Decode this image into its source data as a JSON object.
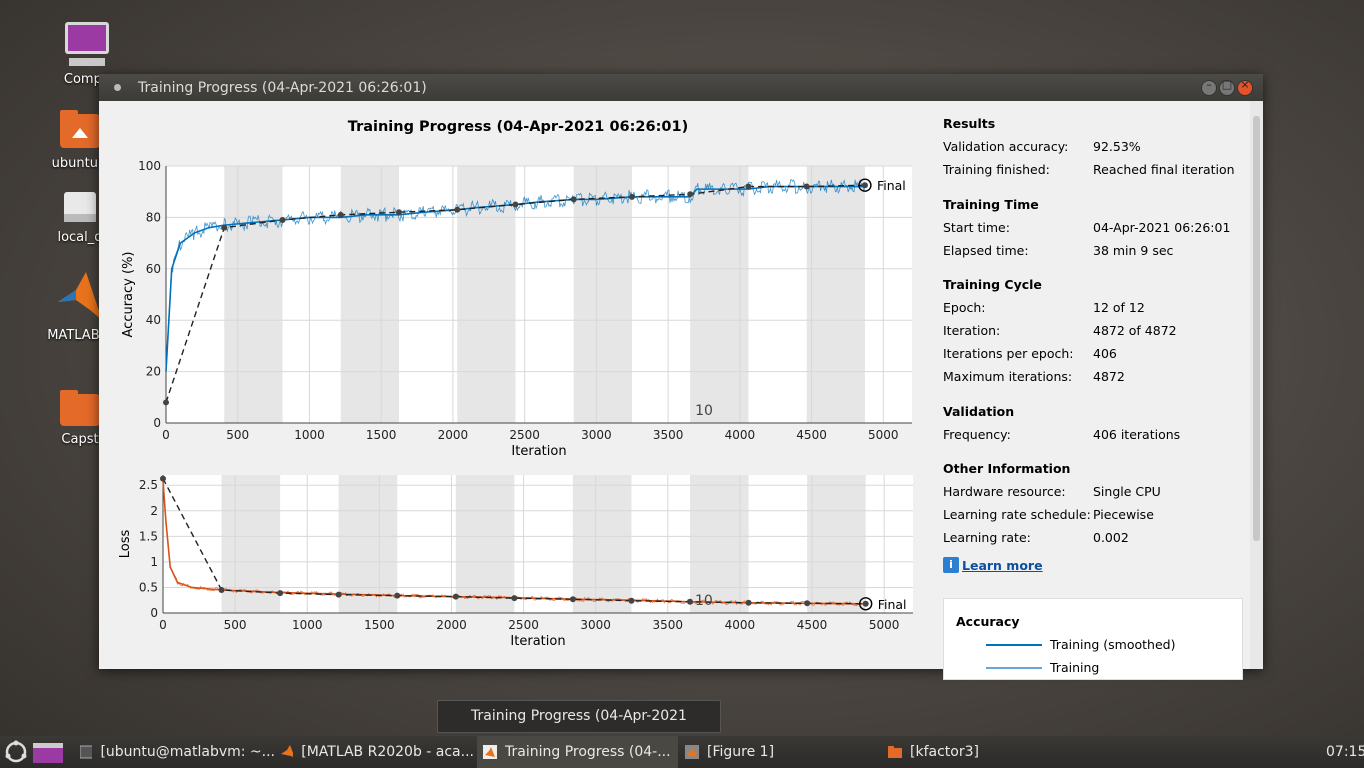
{
  "desktop": {
    "icons": [
      {
        "label": "Compu",
        "icon": "computer-icon"
      },
      {
        "label": "ubuntu's",
        "icon": "home-folder-icon"
      },
      {
        "label": "local_d",
        "icon": "drive-icon"
      },
      {
        "label": "MATLAB R",
        "icon": "matlab-icon"
      },
      {
        "label": "Capst",
        "icon": "folder-icon"
      }
    ]
  },
  "window": {
    "title": "Training Progress (04-Apr-2021 06:26:01)",
    "plot_title": "Training Progress (04-Apr-2021 06:26:01)"
  },
  "chart_data": [
    {
      "type": "line",
      "title": "Training Progress (04-Apr-2021 06:26:01)",
      "xlabel": "Iteration",
      "ylabel": "Accuracy (%)",
      "xlim": [
        0,
        5200
      ],
      "ylim": [
        0,
        100
      ],
      "xticks": [
        "0",
        "500",
        "1000",
        "1500",
        "2000",
        "2500",
        "3000",
        "3500",
        "4000",
        "4500",
        "5000"
      ],
      "yticks": [
        "0",
        "20",
        "40",
        "60",
        "80",
        "100"
      ],
      "epoch_label": "10",
      "final_label": "Final",
      "series": [
        {
          "color": "#0072bd",
          "x": [
            0,
            40,
            100,
            200,
            300,
            406,
            600,
            812,
            1000,
            1218,
            1400,
            1624,
            1800,
            2030,
            2200,
            2436,
            2600,
            2842,
            3000,
            3248,
            3400,
            3654,
            3700,
            3900,
            4060,
            4200,
            4466,
            4700,
            4872
          ],
          "y": [
            20,
            60,
            70,
            74,
            76,
            77,
            78,
            79,
            80,
            80,
            81,
            81,
            82,
            83,
            84,
            85,
            86,
            87,
            87,
            88,
            88,
            88,
            91,
            91,
            91,
            92,
            92,
            92,
            92
          ]
        },
        {
          "color": "#000000",
          "dashed": true,
          "x": [
            0,
            406,
            812,
            1218,
            1624,
            2030,
            2436,
            2842,
            3248,
            3654,
            4060,
            4466,
            4872
          ],
          "y": [
            8,
            76,
            79,
            81,
            82,
            83,
            85,
            87,
            88,
            89,
            92,
            92,
            92.53
          ]
        }
      ]
    },
    {
      "type": "line",
      "xlabel": "Iteration",
      "ylabel": "Loss",
      "xlim": [
        0,
        5200
      ],
      "ylim": [
        0,
        2.7
      ],
      "xticks": [
        "0",
        "500",
        "1000",
        "1500",
        "2000",
        "2500",
        "3000",
        "3500",
        "4000",
        "4500",
        "5000"
      ],
      "yticks": [
        "0",
        "0.5",
        "1",
        "1.5",
        "2",
        "2.5"
      ],
      "epoch_label": "10",
      "final_label": "Final",
      "series": [
        {
          "color": "#d95319",
          "x": [
            0,
            20,
            50,
            100,
            200,
            406,
            812,
            1218,
            1624,
            2030,
            2436,
            2842,
            3248,
            3654,
            4060,
            4466,
            4872
          ],
          "y": [
            2.6,
            1.8,
            0.9,
            0.6,
            0.5,
            0.45,
            0.4,
            0.37,
            0.34,
            0.32,
            0.3,
            0.27,
            0.25,
            0.22,
            0.2,
            0.19,
            0.18
          ]
        },
        {
          "color": "#000000",
          "dashed": true,
          "x": [
            0,
            406,
            812,
            1218,
            1624,
            2030,
            2436,
            2842,
            3248,
            3654,
            4060,
            4466,
            4872
          ],
          "y": [
            2.63,
            0.45,
            0.39,
            0.36,
            0.34,
            0.32,
            0.29,
            0.27,
            0.24,
            0.22,
            0.2,
            0.19,
            0.18
          ]
        }
      ]
    }
  ],
  "panel": {
    "results": {
      "heading": "Results",
      "val_acc_key": "Validation accuracy:",
      "val_acc": "92.53%",
      "finished_key": "Training finished:",
      "finished": "Reached final iteration"
    },
    "time": {
      "heading": "Training Time",
      "start_key": "Start time:",
      "start": "04-Apr-2021 06:26:01",
      "elapsed_key": "Elapsed time:",
      "elapsed": "38 min 9 sec"
    },
    "cycle": {
      "heading": "Training Cycle",
      "epoch_key": "Epoch:",
      "epoch": "12 of 12",
      "iter_key": "Iteration:",
      "iter": "4872 of 4872",
      "ipe_key": "Iterations per epoch:",
      "ipe": "406",
      "max_key": "Maximum iterations:",
      "max": "4872"
    },
    "validation": {
      "heading": "Validation",
      "freq_key": "Frequency:",
      "freq": "406 iterations"
    },
    "other": {
      "heading": "Other Information",
      "hw_key": "Hardware resource:",
      "hw": "Single CPU",
      "lr_sched_key": "Learning rate schedule:",
      "lr_sched": "Piecewise",
      "lr_key": "Learning rate:",
      "lr": "0.002"
    },
    "learn_more": "Learn more",
    "legend": {
      "heading": "Accuracy",
      "smoothed": "Training (smoothed)",
      "raw": "Training"
    }
  },
  "tooltip": "Training Progress (04-Apr-2021 06:26:01)",
  "taskbar": {
    "items": [
      {
        "label": "[ubuntu@matlabvm: ~...",
        "icon": "terminal-icon"
      },
      {
        "label": "[MATLAB R2020b - aca...",
        "icon": "matlab-icon"
      },
      {
        "label": "Training Progress (04-...",
        "icon": "matlab-icon"
      },
      {
        "label": "[Figure 1]",
        "icon": "matlab-icon"
      },
      {
        "label": "[kfactor3]",
        "icon": "folder-icon"
      }
    ],
    "clock": "07:15"
  }
}
